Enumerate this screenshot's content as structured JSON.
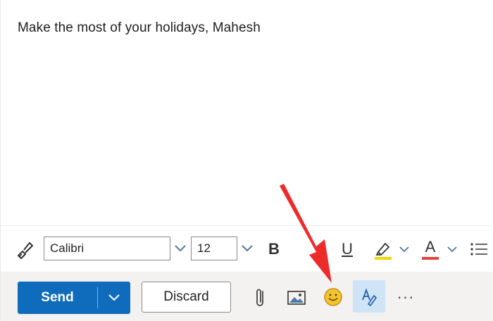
{
  "message": {
    "body_text": "Make the most of your holidays, Mahesh"
  },
  "format_toolbar": {
    "format_painter_icon": "paintbrush-icon",
    "font_name": "Calibri",
    "font_size": "12",
    "bold_label": "B",
    "underline_label": "U",
    "font_color_label": "A",
    "highlight_color": "#f2d600",
    "font_color": "#e0453a",
    "bullets_icon": "bullets-icon"
  },
  "actions": {
    "send_label": "Send",
    "discard_label": "Discard",
    "attach_icon": "paperclip-icon",
    "picture_icon": "picture-icon",
    "emoji_icon": "emoji-icon",
    "editor_icon": "editor-icon",
    "more_label": "···"
  },
  "colors": {
    "accent": "#0f6cbd",
    "arrow": "#ee2b2b",
    "emoji": "#f4c430"
  }
}
